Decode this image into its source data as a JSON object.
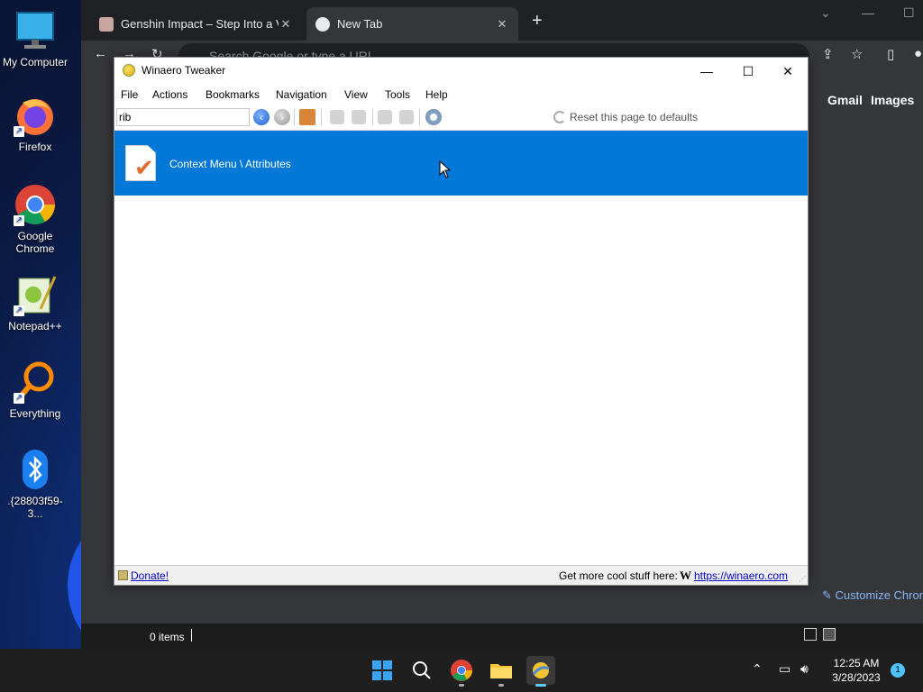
{
  "desktop": {
    "icons": [
      {
        "label": "My Computer",
        "icon": "monitor-icon"
      },
      {
        "label": "Firefox",
        "icon": "firefox-icon"
      },
      {
        "label": "Google Chrome",
        "icon": "chrome-icon"
      },
      {
        "label": "Notepad++",
        "icon": "notepadpp-icon"
      },
      {
        "label": "Everything",
        "icon": "everything-search-icon"
      },
      {
        "label": ".{28803f59-3...",
        "icon": "bluetooth-icon"
      }
    ]
  },
  "chrome": {
    "tabs": [
      {
        "title": "Genshin Impact – Step Into a Vas",
        "close": "✕"
      },
      {
        "title": "New Tab",
        "close": "✕"
      }
    ],
    "new_tab": "+",
    "omnibox_placeholder": "Search Google or type a URL",
    "links": [
      "Gmail",
      "Images"
    ],
    "customize": "Customize Chrome"
  },
  "explorer_status": {
    "items": "0 items"
  },
  "winaero": {
    "title": "Winaero Tweaker",
    "menu": [
      "File",
      "Actions",
      "Bookmarks",
      "Navigation",
      "View",
      "Tools",
      "Help"
    ],
    "search_value": "rib",
    "reset_label": "Reset this page to defaults",
    "result": {
      "label": "Context Menu \\ Attributes"
    },
    "status": {
      "donate": "Donate!",
      "more": "Get more cool stuff here:",
      "logo": "W",
      "site": "https://winaero.com"
    }
  },
  "taskbar": {
    "clock_time": "12:25 AM",
    "clock_date": "3/28/2023",
    "notification_count": "1"
  },
  "colors": {
    "selection": "#0078d7",
    "taskbar": "#1f1f1f",
    "chrome_frame": "#202124"
  }
}
